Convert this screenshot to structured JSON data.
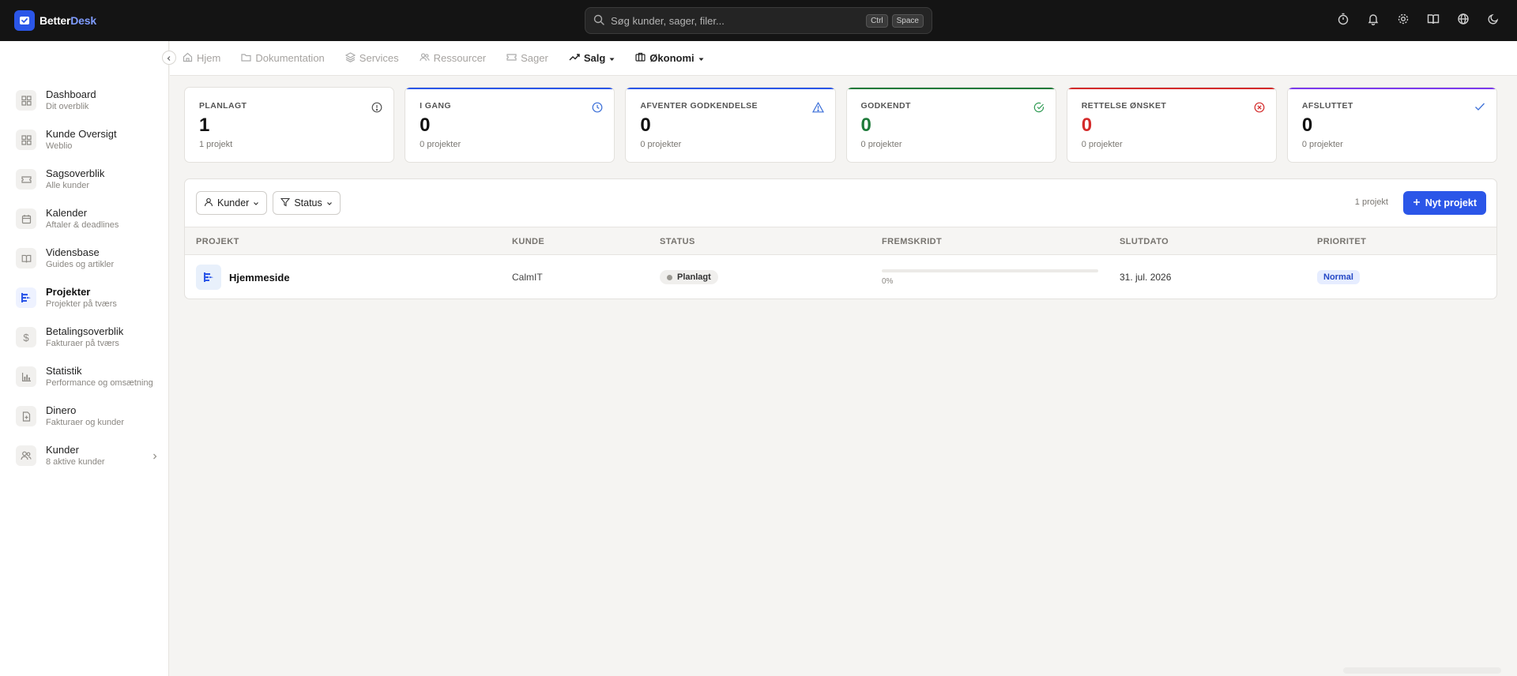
{
  "app": {
    "logo_text_a": "Better",
    "logo_text_b": "Desk"
  },
  "search": {
    "placeholder": "Søg kunder, sager, filer...",
    "kbd_1": "Ctrl",
    "kbd_2": "Space"
  },
  "top_icons": [
    "timer-icon",
    "bell-icon",
    "gear-icon",
    "book-icon",
    "globe-icon",
    "moon-icon"
  ],
  "sidebar": {
    "items": [
      {
        "label": "Dashboard",
        "sub": "Dit overblik",
        "icon": "grid-icon"
      },
      {
        "label": "Kunde Oversigt",
        "sub": "Weblio",
        "icon": "grid-icon"
      },
      {
        "label": "Sagsoverblik",
        "sub": "Alle kunder",
        "icon": "ticket-icon"
      },
      {
        "label": "Kalender",
        "sub": "Aftaler & deadlines",
        "icon": "calendar-icon"
      },
      {
        "label": "Vidensbase",
        "sub": "Guides og artikler",
        "icon": "book-icon"
      },
      {
        "label": "Projekter",
        "sub": "Projekter på tværs",
        "icon": "project-icon"
      },
      {
        "label": "Betalingsoverblik",
        "sub": "Fakturaer på tværs",
        "icon": "dollar-icon"
      },
      {
        "label": "Statistik",
        "sub": "Performance og omsætning",
        "icon": "bar-chart-icon"
      },
      {
        "label": "Dinero",
        "sub": "Fakturaer og kunder",
        "icon": "file-plus-icon"
      },
      {
        "label": "Kunder",
        "sub": "8 aktive kunder",
        "icon": "users-icon"
      }
    ]
  },
  "subnav": {
    "items": [
      {
        "label": "Hjem",
        "icon": "home-icon"
      },
      {
        "label": "Dokumentation",
        "icon": "folder-icon"
      },
      {
        "label": "Services",
        "icon": "layers-icon"
      },
      {
        "label": "Ressourcer",
        "icon": "users-icon"
      },
      {
        "label": "Sager",
        "icon": "ticket-icon"
      },
      {
        "label": "Salg",
        "icon": "trend-icon"
      },
      {
        "label": "Økonomi",
        "icon": "briefcase-icon"
      }
    ]
  },
  "cards": [
    {
      "title": "Planlagt",
      "value": "1",
      "sub": "1 projekt",
      "accent": "#ffffff",
      "value_color": "#111111",
      "icon_color": "#555555"
    },
    {
      "title": "I gang",
      "value": "0",
      "sub": "0 projekter",
      "accent": "#2b56e8",
      "value_color": "#111111",
      "icon_color": "#3b6fd8"
    },
    {
      "title": "Afventer godkendelse",
      "value": "0",
      "sub": "0 projekter",
      "accent": "#2b56e8",
      "value_color": "#111111",
      "icon_color": "#3b6fd8"
    },
    {
      "title": "Godkendt",
      "value": "0",
      "sub": "0 projekter",
      "accent": "#1e7a3a",
      "value_color": "#1e7a3a",
      "icon_color": "#2e9a52"
    },
    {
      "title": "Rettelse ønsket",
      "value": "0",
      "sub": "0 projekter",
      "accent": "#d42b2b",
      "value_color": "#d42b2b",
      "icon_color": "#d42b2b"
    },
    {
      "title": "Afsluttet",
      "value": "0",
      "sub": "0 projekter",
      "accent": "#7c3aed",
      "value_color": "#111111",
      "icon_color": "#3b6fd8"
    }
  ],
  "toolbar": {
    "filter_customers": "Kunder",
    "filter_status": "Status",
    "count": "1 projekt",
    "new_label": "Nyt projekt"
  },
  "table": {
    "headers": [
      "Projekt",
      "Kunde",
      "Status",
      "Fremskridt",
      "Slutdato",
      "Prioritet"
    ],
    "rows": [
      {
        "name": "Hjemmeside",
        "customer": "CalmIT",
        "status": "Planlagt",
        "progress": 0,
        "progress_text": "0%",
        "due": "31. jul. 2026",
        "priority": "Normal"
      }
    ]
  }
}
